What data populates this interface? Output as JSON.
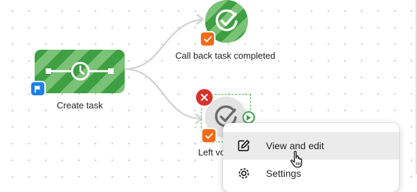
{
  "nodes": {
    "create_task": {
      "label": "Create task",
      "icon": "timer-icon",
      "badge_icon": "flag-icon"
    },
    "callback_task": {
      "label": "Call back task completed",
      "icon": "check-circle-icon",
      "badge_icon": "checkbox-icon"
    },
    "voicemail_task": {
      "label": "Left vo",
      "icon": "check-circle-icon",
      "badge_icon": "checkbox-icon",
      "selected": true
    }
  },
  "node_actions": {
    "delete_icon": "close-icon",
    "run_icon": "play-icon"
  },
  "context_menu": {
    "items": [
      {
        "label": "View and edit",
        "icon": "edit-icon",
        "hovered": true
      },
      {
        "label": "Settings",
        "icon": "gear-icon",
        "hovered": false
      }
    ]
  },
  "colors": {
    "stripe_dark": "#3e9f43",
    "stripe_light": "#7ac276",
    "badge_orange": "#f46a17",
    "flag_blue": "#1e7fe6",
    "delete_red": "#d9312c",
    "selection_green": "#47b44b"
  }
}
